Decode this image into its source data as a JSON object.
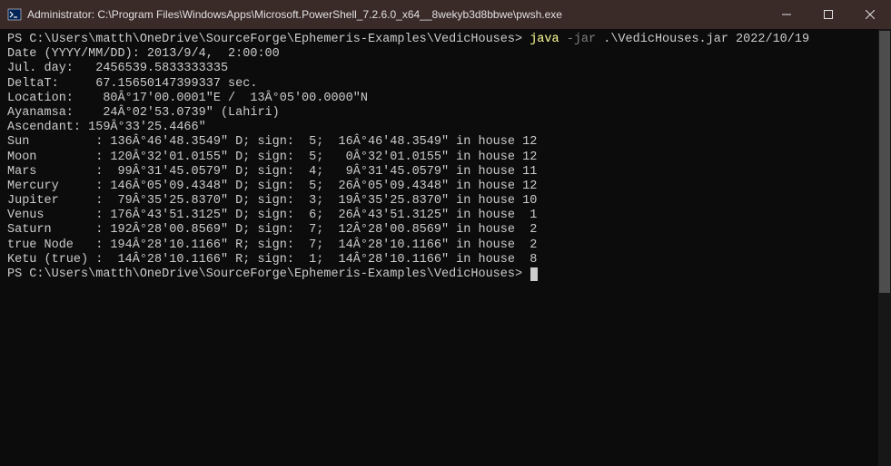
{
  "titlebar": {
    "title": "Administrator: C:\\Program Files\\WindowsApps\\Microsoft.PowerShell_7.2.6.0_x64__8wekyb3d8bbwe\\pwsh.exe"
  },
  "terminal": {
    "prompt1": "PS C:\\Users\\matth\\OneDrive\\SourceForge\\Ephemeris-Examples\\VedicHouses> ",
    "cmd_java": "java",
    "cmd_flag": "-jar",
    "cmd_args": ".\\VedicHouses.jar 2022/10/19",
    "lines": [
      "Date (YYYY/MM/DD): 2013/9/4,  2:00:00",
      "Jul. day:   2456539.5833333335",
      "DeltaT:     67.15650147399337 sec.",
      "Location:    80Â°17'00.0001\"E /  13Â°05'00.0000\"N",
      "Ayanamsa:    24Â°02'53.0739\" (Lahiri)",
      "Ascendant: 159Â°33'25.4466\"",
      "",
      "Sun         : 136Â°46'48.3549\" D; sign:  5;  16Â°46'48.3549\" in house 12",
      "Moon        : 120Â°32'01.0155\" D; sign:  5;   0Â°32'01.0155\" in house 12",
      "Mars        :  99Â°31'45.0579\" D; sign:  4;   9Â°31'45.0579\" in house 11",
      "Mercury     : 146Â°05'09.4348\" D; sign:  5;  26Â°05'09.4348\" in house 12",
      "Jupiter     :  79Â°35'25.8370\" D; sign:  3;  19Â°35'25.8370\" in house 10",
      "Venus       : 176Â°43'51.3125\" D; sign:  6;  26Â°43'51.3125\" in house  1",
      "Saturn      : 192Â°28'00.8569\" D; sign:  7;  12Â°28'00.8569\" in house  2",
      "true Node   : 194Â°28'10.1166\" R; sign:  7;  14Â°28'10.1166\" in house  2",
      "Ketu (true) :  14Â°28'10.1166\" R; sign:  1;  14Â°28'10.1166\" in house  8"
    ],
    "prompt2": "PS C:\\Users\\matth\\OneDrive\\SourceForge\\Ephemeris-Examples\\VedicHouses> "
  }
}
